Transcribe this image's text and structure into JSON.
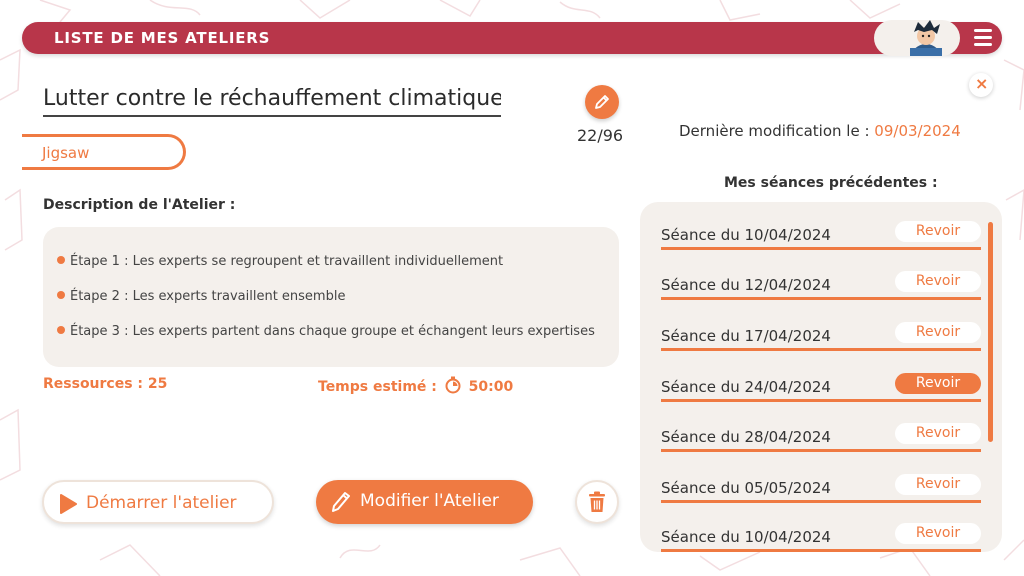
{
  "header": {
    "title": "LISTE DE MES ATELIERS"
  },
  "atelier": {
    "title": "Lutter contre le réchauffement climatique…",
    "counter": "22/96",
    "type": "Jigsaw",
    "description_label": "Description de l'Atelier :",
    "steps": [
      "Étape 1 : Les experts se regroupent et travaillent individuellement",
      "Étape 2 : Les experts travaillent ensemble",
      "Étape 3 : Les experts partent dans chaque groupe et échangent leurs expertises"
    ],
    "resources": "Ressources : 25",
    "time_label": "Temps estimé :",
    "time_value": "50:00"
  },
  "actions": {
    "start_label": "Démarrer l'atelier",
    "edit_label": "Modifier l'Atelier"
  },
  "right": {
    "last_mod_label": "Dernière modification le :",
    "last_mod_date": "09/03/2024",
    "sessions_title": "Mes séances précédentes :",
    "sessions": [
      {
        "label": "Séance du 10/04/2024",
        "button": "Revoir",
        "active": false
      },
      {
        "label": "Séance du 12/04/2024",
        "button": "Revoir",
        "active": false
      },
      {
        "label": "Séance du 17/04/2024",
        "button": "Revoir",
        "active": false
      },
      {
        "label": "Séance du 24/04/2024",
        "button": "Revoir",
        "active": true
      },
      {
        "label": "Séance du 28/04/2024",
        "button": "Revoir",
        "active": false
      },
      {
        "label": "Séance du 05/05/2024",
        "button": "Revoir",
        "active": false
      },
      {
        "label": "Séance du 10/04/2024",
        "button": "Revoir",
        "active": false
      }
    ]
  },
  "colors": {
    "header": "#b8364a",
    "accent": "#ef7a42",
    "panel": "#f4f0ec"
  },
  "icons": {
    "menu": "hamburger-icon",
    "close": "close-icon",
    "edit": "pencil-icon",
    "play": "play-icon",
    "timer": "stopwatch-icon",
    "trash": "trash-icon"
  }
}
